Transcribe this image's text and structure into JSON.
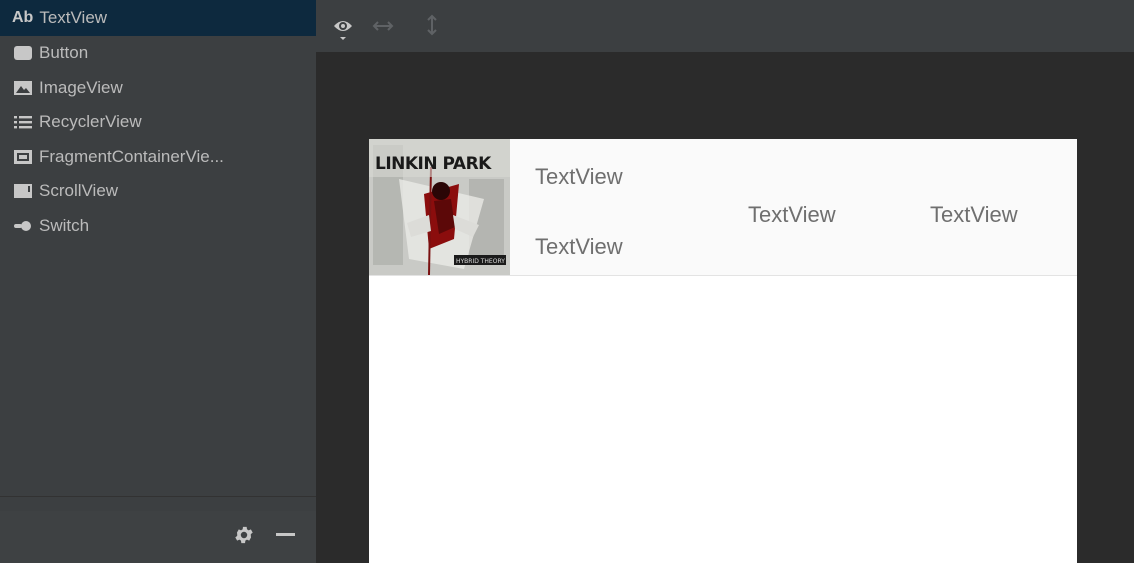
{
  "palette": {
    "items": [
      {
        "icon": "ab-text-icon",
        "icon_text": "Ab",
        "label": "TextView"
      },
      {
        "icon": "button-icon",
        "label": "Button"
      },
      {
        "icon": "image-icon",
        "label": "ImageView"
      },
      {
        "icon": "list-icon",
        "label": "RecyclerView"
      },
      {
        "icon": "fragment-container-icon",
        "label": "FragmentContainerVie..."
      },
      {
        "icon": "scroll-view-icon",
        "label": "ScrollView"
      },
      {
        "icon": "switch-icon",
        "label": "Switch"
      }
    ],
    "selected_index": 0
  },
  "canvas": {
    "item": {
      "album_art": "Linkin Park - Hybrid Theory album cover",
      "album_title_text": "LINKIN PARK",
      "album_label_text": "HYBRID THEORY",
      "text_top": "TextView",
      "text_bottom": "TextView",
      "text_mid": "TextView",
      "text_right": "TextView"
    }
  },
  "colors": {
    "panel_bg": "#3c3f41",
    "editor_bg": "#2b2b2b",
    "selection_bg": "#0d293e",
    "palette_text": "#bbbbbb",
    "canvas_bg": "#ffffff",
    "textview_color": "#6f6f6f"
  }
}
